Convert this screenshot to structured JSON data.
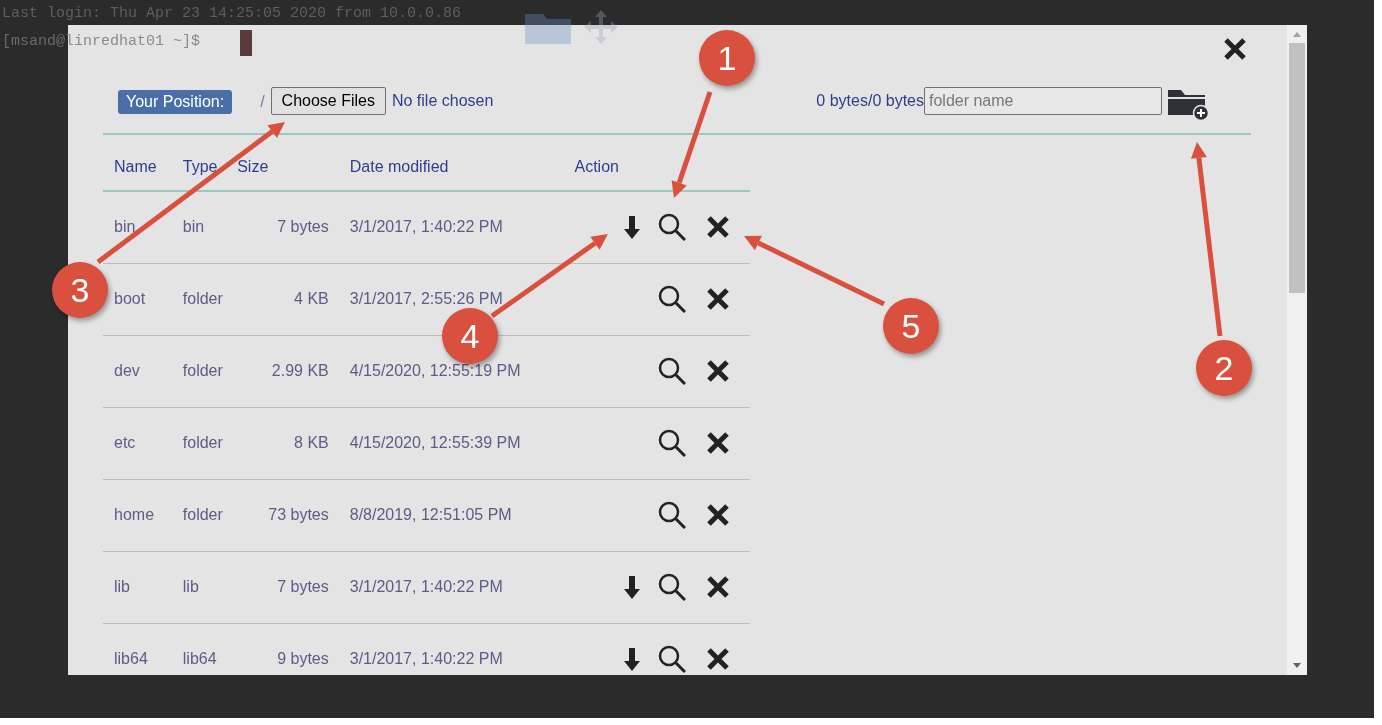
{
  "terminal": {
    "lines": [
      "Last login: Thu Apr 23 14:25:05 2020 from 10.0.0.86"
    ],
    "prompt_user": "[msand@",
    "prompt_host": "linredhat01 ~]$"
  },
  "dialog": {
    "position_label": "Your Position:",
    "path": "/",
    "file_button": "Choose Files",
    "file_status": "No file chosen",
    "usage": {
      "used": "0 bytes",
      "separator": "/",
      "total": "0 bytes"
    },
    "folder_field": {
      "placeholder": "folder name"
    },
    "table": {
      "columns": [
        "Name",
        "Type",
        "Size",
        "Date modified",
        "Action"
      ],
      "rows": [
        {
          "name": "bin",
          "type": "bin",
          "size": "7 bytes",
          "date": "3/1/2017, 1:40:22 PM",
          "download": true
        },
        {
          "name": "boot",
          "type": "folder",
          "size": "4 KB",
          "date": "3/1/2017, 2:55:26 PM",
          "download": false
        },
        {
          "name": "dev",
          "type": "folder",
          "size": "2.99 KB",
          "date": "4/15/2020, 12:55:19 PM",
          "download": false
        },
        {
          "name": "etc",
          "type": "folder",
          "size": "8 KB",
          "date": "4/15/2020, 12:55:39 PM",
          "download": false
        },
        {
          "name": "home",
          "type": "folder",
          "size": "73 bytes",
          "date": "8/8/2019, 12:51:05 PM",
          "download": false
        },
        {
          "name": "lib",
          "type": "lib",
          "size": "7 bytes",
          "date": "3/1/2017, 1:40:22 PM",
          "download": true
        },
        {
          "name": "lib64",
          "type": "lib64",
          "size": "9 bytes",
          "date": "3/1/2017, 1:40:22 PM",
          "download": true
        }
      ]
    }
  },
  "callouts": [
    {
      "number": "1"
    },
    {
      "number": "2"
    },
    {
      "number": "3"
    },
    {
      "number": "4"
    },
    {
      "number": "5"
    }
  ]
}
